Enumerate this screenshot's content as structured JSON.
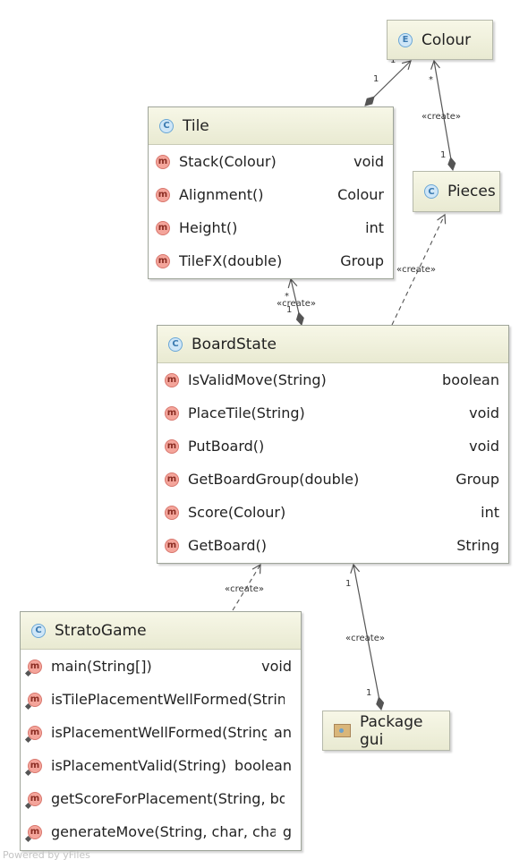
{
  "diagram": {
    "nodes": {
      "colour": {
        "kind_letter": "E",
        "title": "Colour"
      },
      "tile": {
        "kind_letter": "C",
        "title": "Tile",
        "methods": [
          {
            "icon": "m",
            "name": "Stack(Colour)",
            "type": "void"
          },
          {
            "icon": "m",
            "name": "Alignment()",
            "type": "Colour"
          },
          {
            "icon": "m",
            "name": "Height()",
            "type": "int"
          },
          {
            "icon": "m",
            "name": "TileFX(double)",
            "type": "Group"
          }
        ]
      },
      "pieces": {
        "kind_letter": "C",
        "title": "Pieces"
      },
      "boardstate": {
        "kind_letter": "C",
        "title": "BoardState",
        "methods": [
          {
            "icon": "m",
            "name": "IsValidMove(String)",
            "type": "boolean"
          },
          {
            "icon": "m",
            "name": "PlaceTile(String)",
            "type": "void"
          },
          {
            "icon": "m",
            "name": "PutBoard()",
            "type": "void"
          },
          {
            "icon": "m",
            "name": "GetBoardGroup(double)",
            "type": "Group"
          },
          {
            "icon": "m",
            "name": "Score(Colour)",
            "type": "int"
          },
          {
            "icon": "m",
            "name": "GetBoard()",
            "type": "String"
          }
        ]
      },
      "stratogame": {
        "kind_letter": "C",
        "title": "StratoGame",
        "methods": [
          {
            "icon": "m",
            "name": "main(String[])",
            "type": "void"
          },
          {
            "icon": "m",
            "name": "isTilePlacementWellFormed(String)",
            "type": ""
          },
          {
            "icon": "m",
            "name": "isPlacementWellFormed(String)",
            "type": "an"
          },
          {
            "icon": "m",
            "name": "isPlacementValid(String)",
            "type": "boolean"
          },
          {
            "icon": "m",
            "name": "getScoreForPlacement(String, boole",
            "type": ""
          },
          {
            "icon": "m",
            "name": "generateMove(String, char, char)",
            "type": "g"
          }
        ]
      },
      "gui": {
        "title": "Package gui"
      }
    },
    "edges": {
      "tile_colour": {
        "from_mult": "1",
        "to_mult": "1"
      },
      "pieces_colour": {
        "label": "«create»",
        "from_mult": "1",
        "to_mult": "*"
      },
      "boardstate_pieces": {
        "label": "«create»"
      },
      "boardstate_tile": {
        "label": "«create»",
        "from_mult": "1",
        "to_mult": "*"
      },
      "stratogame_boardstate": {
        "label": "«create»"
      },
      "gui_boardstate": {
        "label": "«create»",
        "from_mult": "1",
        "to_mult": "1"
      }
    }
  },
  "watermark": "Powered by yFiles"
}
